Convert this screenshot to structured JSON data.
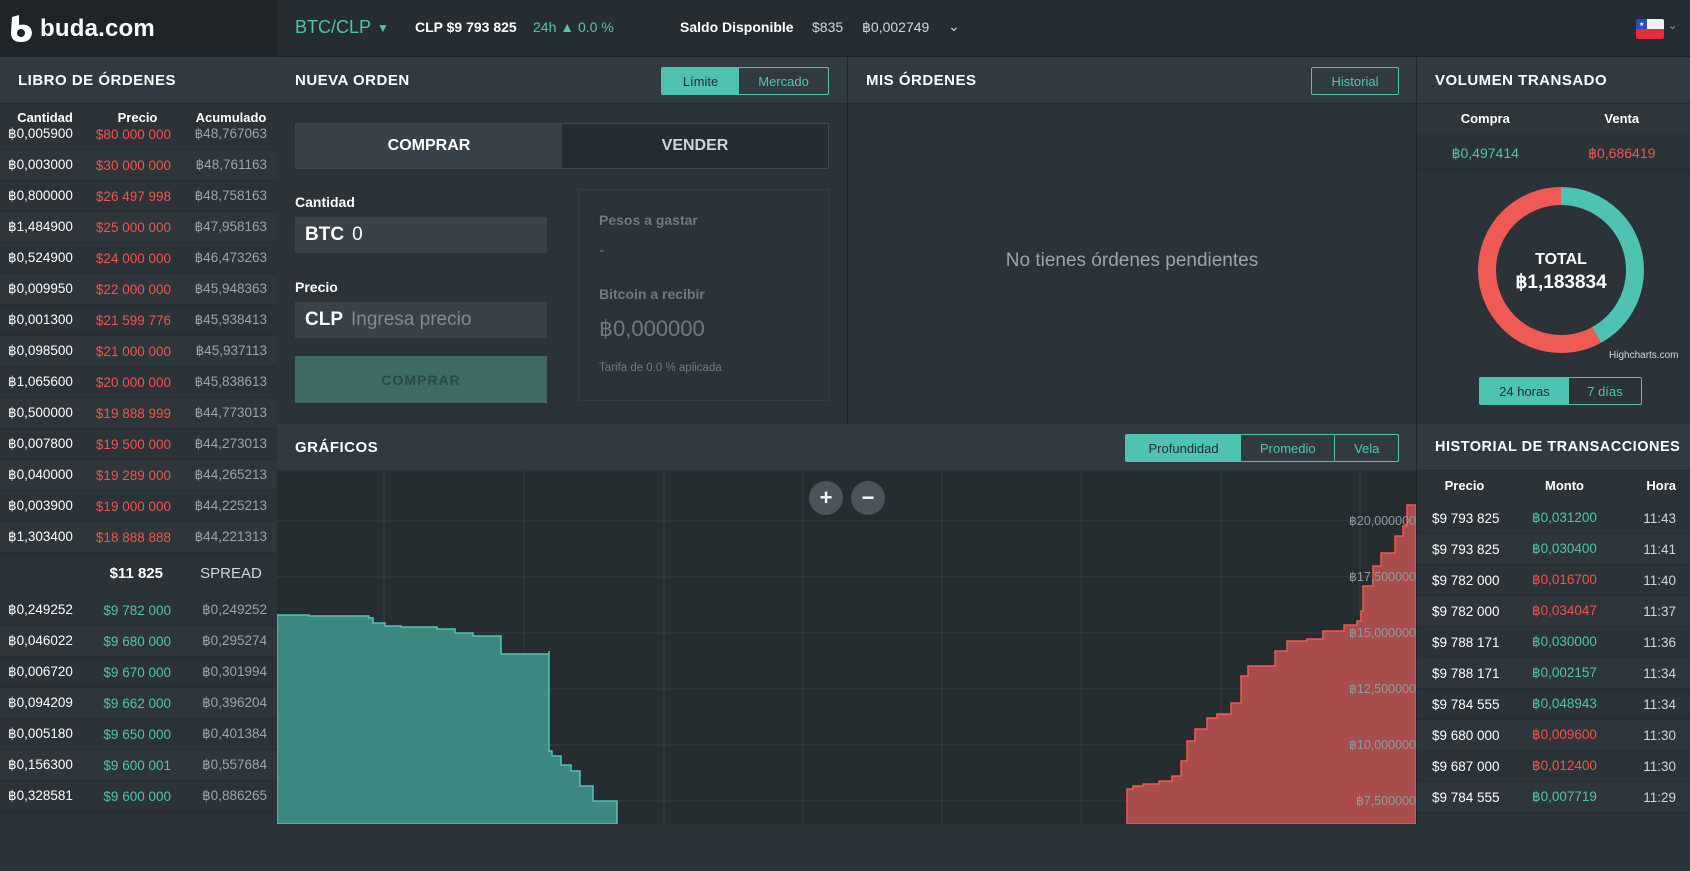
{
  "header": {
    "logo_text": "buda.com",
    "market": "BTC/CLP",
    "last_price": "CLP $9 793 825",
    "change": "24h ▲ 0.0 %",
    "saldo_label": "Saldo Disponible",
    "saldo_clp": "$835",
    "saldo_btc": "฿0,002749"
  },
  "order_book": {
    "title": "LIBRO DE ÓRDENES",
    "columns": [
      "Cantidad",
      "Precio",
      "Acumulado"
    ],
    "asks": [
      [
        "฿0,005900",
        "$80 000 000",
        "฿48,767063"
      ],
      [
        "฿0,003000",
        "$30 000 000",
        "฿48,761163"
      ],
      [
        "฿0,800000",
        "$26 497 998",
        "฿48,758163"
      ],
      [
        "฿1,484900",
        "$25 000 000",
        "฿47,958163"
      ],
      [
        "฿0,524900",
        "$24 000 000",
        "฿46,473263"
      ],
      [
        "฿0,009950",
        "$22 000 000",
        "฿45,948363"
      ],
      [
        "฿0,001300",
        "$21 599 776",
        "฿45,938413"
      ],
      [
        "฿0,098500",
        "$21 000 000",
        "฿45,937113"
      ],
      [
        "฿1,065600",
        "$20 000 000",
        "฿45,838613"
      ],
      [
        "฿0,500000",
        "$19 888 999",
        "฿44,773013"
      ],
      [
        "฿0,007800",
        "$19 500 000",
        "฿44,273013"
      ],
      [
        "฿0,040000",
        "$19 289 000",
        "฿44,265213"
      ],
      [
        "฿0,003900",
        "$19 000 000",
        "฿44,225213"
      ],
      [
        "฿1,303400",
        "$18 888 888",
        "฿44,221313"
      ]
    ],
    "spread_value": "$11 825",
    "spread_label": "SPREAD",
    "bids": [
      [
        "฿0,249252",
        "$9 782 000",
        "฿0,249252"
      ],
      [
        "฿0,046022",
        "$9 680 000",
        "฿0,295274"
      ],
      [
        "฿0,006720",
        "$9 670 000",
        "฿0,301994"
      ],
      [
        "฿0,094209",
        "$9 662 000",
        "฿0,396204"
      ],
      [
        "฿0,005180",
        "$9 650 000",
        "฿0,401384"
      ],
      [
        "฿0,156300",
        "$9 600 001",
        "฿0,557684"
      ],
      [
        "฿0,328581",
        "$9 600 000",
        "฿0,886265"
      ]
    ]
  },
  "new_order": {
    "title": "NUEVA ORDEN",
    "type_limit": "Límite",
    "type_market": "Mercado",
    "buy_tab": "COMPRAR",
    "sell_tab": "VENDER",
    "qty_label": "Cantidad",
    "qty_unit": "BTC",
    "qty_value": "0",
    "price_label": "Precio",
    "price_unit": "CLP",
    "price_placeholder": "Ingresa precio",
    "submit": "COMPRAR",
    "spend_label": "Pesos a gastar",
    "spend_value": "-",
    "receive_label": "Bitcoin a recibir",
    "receive_value": "฿0,000000",
    "fee": "Tarifa de 0.0 % aplicada"
  },
  "my_orders": {
    "title": "MIS ÓRDENES",
    "history_button": "Historial",
    "empty": "No tienes órdenes pendientes"
  },
  "volume": {
    "title": "VOLUMEN TRANSADO",
    "buy_label": "Compra",
    "sell_label": "Venta",
    "buy_value": "฿0,497414",
    "sell_value": "฿0,686419",
    "total_label": "TOTAL",
    "total_value": "฿1,183834",
    "credit": "Highcharts.com",
    "period_24h": "24 horas",
    "period_7d": "7 días",
    "colors": {
      "buy": "#4fc3b2",
      "sell": "#f05a55"
    }
  },
  "charts": {
    "title": "GRÁFICOS",
    "tab_depth": "Profundidad",
    "tab_avg": "Promedio",
    "tab_candle": "Vela",
    "zoom_in": "+",
    "zoom_out": "−",
    "y_labels": [
      "฿20,000000",
      "฿17,500000",
      "฿15,000000",
      "฿12,500000",
      "฿10,000000",
      "฿7,500000"
    ]
  },
  "history": {
    "title": "HISTORIAL DE TRANSACCIONES",
    "columns": [
      "Precio",
      "Monto",
      "Hora"
    ],
    "rows": [
      [
        "$9 793 825",
        "฿0,031200",
        "11:43",
        "buy"
      ],
      [
        "$9 793 825",
        "฿0,030400",
        "11:41",
        "buy"
      ],
      [
        "$9 782 000",
        "฿0,016700",
        "11:40",
        "sell"
      ],
      [
        "$9 782 000",
        "฿0,034047",
        "11:37",
        "sell"
      ],
      [
        "$9 788 171",
        "฿0,030000",
        "11:36",
        "buy"
      ],
      [
        "$9 788 171",
        "฿0,002157",
        "11:34",
        "buy"
      ],
      [
        "$9 784 555",
        "฿0,048943",
        "11:34",
        "buy"
      ],
      [
        "$9 680 000",
        "฿0,009600",
        "11:30",
        "sell"
      ],
      [
        "$9 687 000",
        "฿0,012400",
        "11:30",
        "sell"
      ],
      [
        "$9 784 555",
        "฿0,007719",
        "11:29",
        "buy"
      ]
    ]
  }
}
